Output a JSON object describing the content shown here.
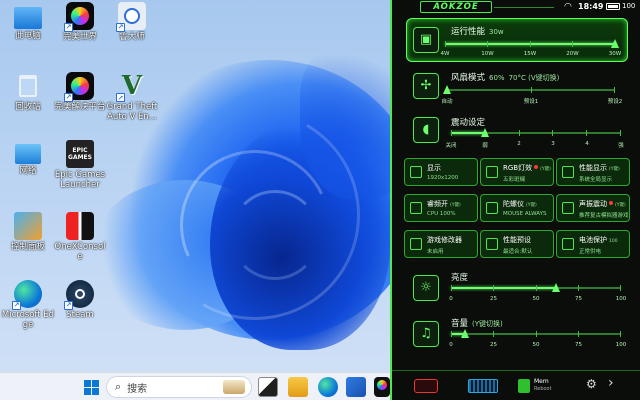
{
  "desktop": {
    "icons": [
      {
        "label": "此电脑"
      },
      {
        "label": "完美世界"
      },
      {
        "label": "鲁大师"
      },
      {
        "label": "回收站"
      },
      {
        "label": "完美解决平台"
      },
      {
        "label": "Grand Theft Auto V En..."
      },
      {
        "label": "网络"
      },
      {
        "label": "Epic Games Launcher"
      },
      {
        "label": "控制面板"
      },
      {
        "label": "OneXConsole"
      },
      {
        "label": "Microsoft Edge"
      },
      {
        "label": "Steam"
      }
    ],
    "epic_text": "EPIC\nGAMES",
    "gta_glyph": "V"
  },
  "taskbar": {
    "search_placeholder": "搜索",
    "search_glyph": "⌕"
  },
  "panel": {
    "brand": "AOKZOE",
    "clock": "18:49",
    "battery": "100",
    "performance": {
      "title": "运行性能",
      "value": "30w",
      "ticks": [
        "4W",
        "10W",
        "15W",
        "20W",
        "30W"
      ],
      "level": 1.0
    },
    "fan": {
      "title": "风扇模式",
      "value": "60%",
      "sub": "70°C  (V键切换)",
      "ticks": [
        "自动",
        "预设1",
        "预设2"
      ],
      "level": 0.0
    },
    "vibration": {
      "title": "震动设定",
      "ticks": [
        "关闭",
        "弱",
        "2",
        "3",
        "4",
        "强"
      ],
      "level": 0.2
    },
    "buttons": [
      {
        "title": "显示",
        "sub": "1920x1200",
        "hint": ""
      },
      {
        "title": "RGB灯效",
        "sub": "五彩斑斓",
        "hint": "(Y键)"
      },
      {
        "title": "性能显示",
        "sub": "系统全局显示",
        "hint": "(Y键)"
      },
      {
        "title": "睿频开",
        "sub": "CPU 100%",
        "hint": "(Y键)"
      },
      {
        "title": "陀螺仪",
        "sub": "MOUSE ALWAYS",
        "hint": "(Y键)"
      },
      {
        "title": "声振震动",
        "sub": "推荐复古模拟器游戏",
        "hint": "(Y键)"
      },
      {
        "title": "游戏修改器",
        "sub": "未启用",
        "hint": ""
      },
      {
        "title": "性能预设",
        "sub": "最适合:默认",
        "hint": ""
      },
      {
        "title": "电池保护",
        "sub": "正常供电",
        "hint": "100"
      }
    ],
    "brightness": {
      "title": "亮度",
      "ticks": [
        "0",
        "25",
        "50",
        "75",
        "100"
      ],
      "level": 0.62
    },
    "volume": {
      "title": "音量",
      "sub": "(Y键切换)",
      "ticks": [
        "0",
        "25",
        "50",
        "75",
        "100"
      ],
      "level": 0.08
    },
    "bottom": {
      "mem_label": "Mem",
      "mem_sub": "Reboot"
    }
  }
}
